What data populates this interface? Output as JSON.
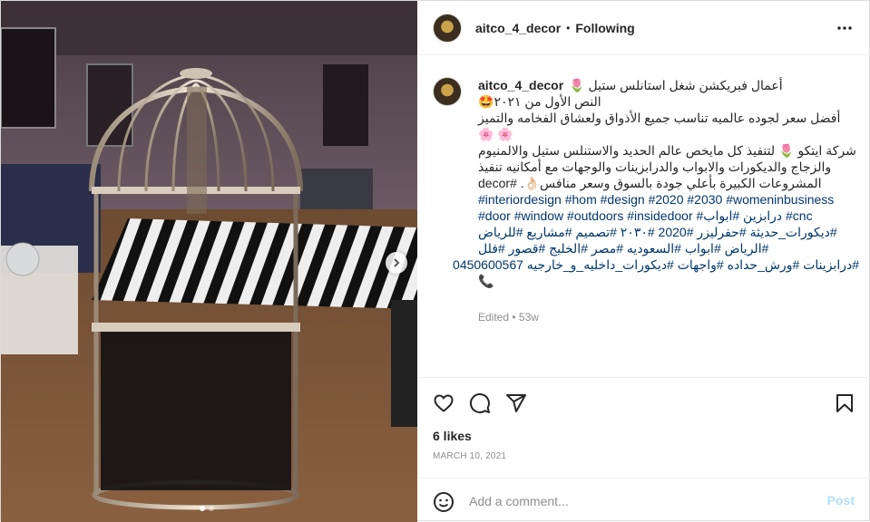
{
  "post": {
    "username": "aitco_4_decor",
    "bullet": "•",
    "follow_status": "Following",
    "caption_lines": [
      "أعمال فبريكشن شغل استانلس ستيل 🌷",
      "النص الأول من ٢٠٢١🤩",
      "أفضل سعر لجوده عالميه تناسب جميع الأذواق ولعشاق الفخامه والتميز",
      "🌸 🌸",
      "شركة ايتكو 🌷 لتنفيذ كل مايخص عالم الحديد والاستنلس ستيل والالمنيوم",
      "والزجاج والديكورات والابواب والدرابزينات والوجهات مع أمكانيه تنفيذ",
      "المشروعات الكبيرة بأعلي جودة بالسوق وسعر منافس👌🏻. #decor"
    ],
    "hashtag_lines": [
      "#interiordesign #hom #design #2020 #2030 #womeninbusiness",
      "#door #window #outdoors #insidedoor #درابزين #ابواب #cnc",
      "#ديكورات_حديثة #حفرليزر #2020 #٢٠٣٠ #تصميم #مشاريع #للرياض",
      "#الرياض #ابواب #السعوديه #مصر #الخليج #قصور #فلل",
      "#درابزينات #ورش_حداده #واجهات #ديكورات_داخليه_و_خارجيه 0450600567",
      "📞"
    ],
    "edited": "Edited",
    "edited_sep": "•",
    "age": "53w",
    "likes": "6 likes",
    "date": "MARCH 10, 2021",
    "comment_placeholder": "Add a comment...",
    "post_label": "Post"
  },
  "icons": {
    "more": "more-horizontal-icon",
    "like": "heart-icon",
    "comment": "comment-icon",
    "share": "share-icon",
    "save": "bookmark-icon",
    "emoji": "emoji-icon",
    "next": "chevron-right-icon"
  },
  "colors": {
    "link": "#00376b",
    "muted": "#8e8e8e",
    "post_disabled": "#b2dffc",
    "border": "#dbdbdb"
  },
  "carousel": {
    "slides": 2,
    "current": 1
  }
}
